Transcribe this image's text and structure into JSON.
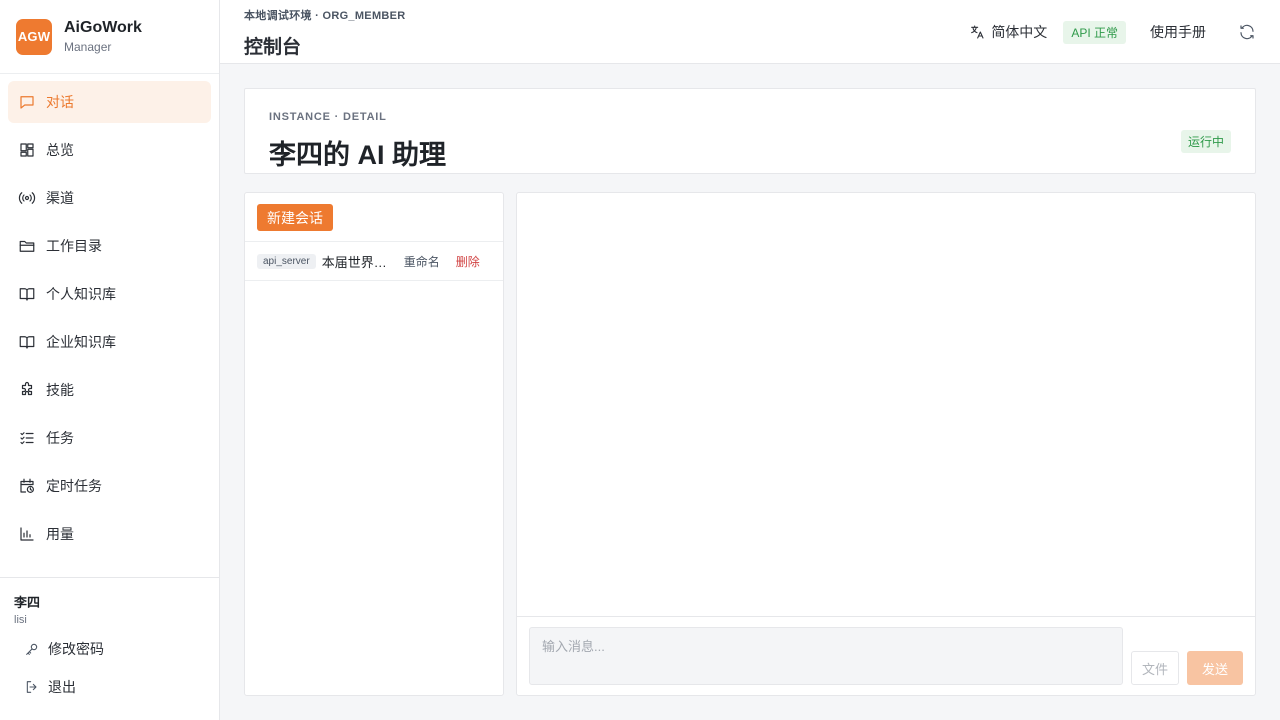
{
  "brand": {
    "logo": "AGW",
    "name": "AiGoWork",
    "role": "Manager"
  },
  "sidebar": {
    "items": [
      {
        "label": "对话",
        "icon": "chat-icon",
        "active": true
      },
      {
        "label": "总览",
        "icon": "dashboard-icon"
      },
      {
        "label": "渠道",
        "icon": "broadcast-icon"
      },
      {
        "label": "工作目录",
        "icon": "folder-icon"
      },
      {
        "label": "个人知识库",
        "icon": "book-icon"
      },
      {
        "label": "企业知识库",
        "icon": "book-icon"
      },
      {
        "label": "技能",
        "icon": "puzzle-icon"
      },
      {
        "label": "任务",
        "icon": "checklist-icon"
      },
      {
        "label": "定时任务",
        "icon": "calendar-clock-icon"
      },
      {
        "label": "用量",
        "icon": "bar-chart-icon"
      }
    ]
  },
  "user": {
    "name": "李四",
    "id": "lisi",
    "change_password": "修改密码",
    "logout": "退出"
  },
  "header": {
    "env": "本地调试环境 · ORG_MEMBER",
    "title": "控制台",
    "language": "简体中文",
    "api_status": "API 正常",
    "manual": "使用手册"
  },
  "instance": {
    "kicker": "INSTANCE · DETAIL",
    "title": "李四的 AI 助理",
    "status": "运行中"
  },
  "sessions": {
    "new_label": "新建会话",
    "items": [
      {
        "tag": "api_server",
        "title": "本届世界杯冠军",
        "rename": "重命名",
        "delete": "删除"
      }
    ]
  },
  "chat": {
    "placeholder": "输入消息...",
    "file_label": "文件",
    "send_label": "发送"
  },
  "colors": {
    "accent": "#ee7a30",
    "accent_light": "#fdf1e8",
    "success": "#2f9a4a",
    "danger": "#d14343"
  }
}
